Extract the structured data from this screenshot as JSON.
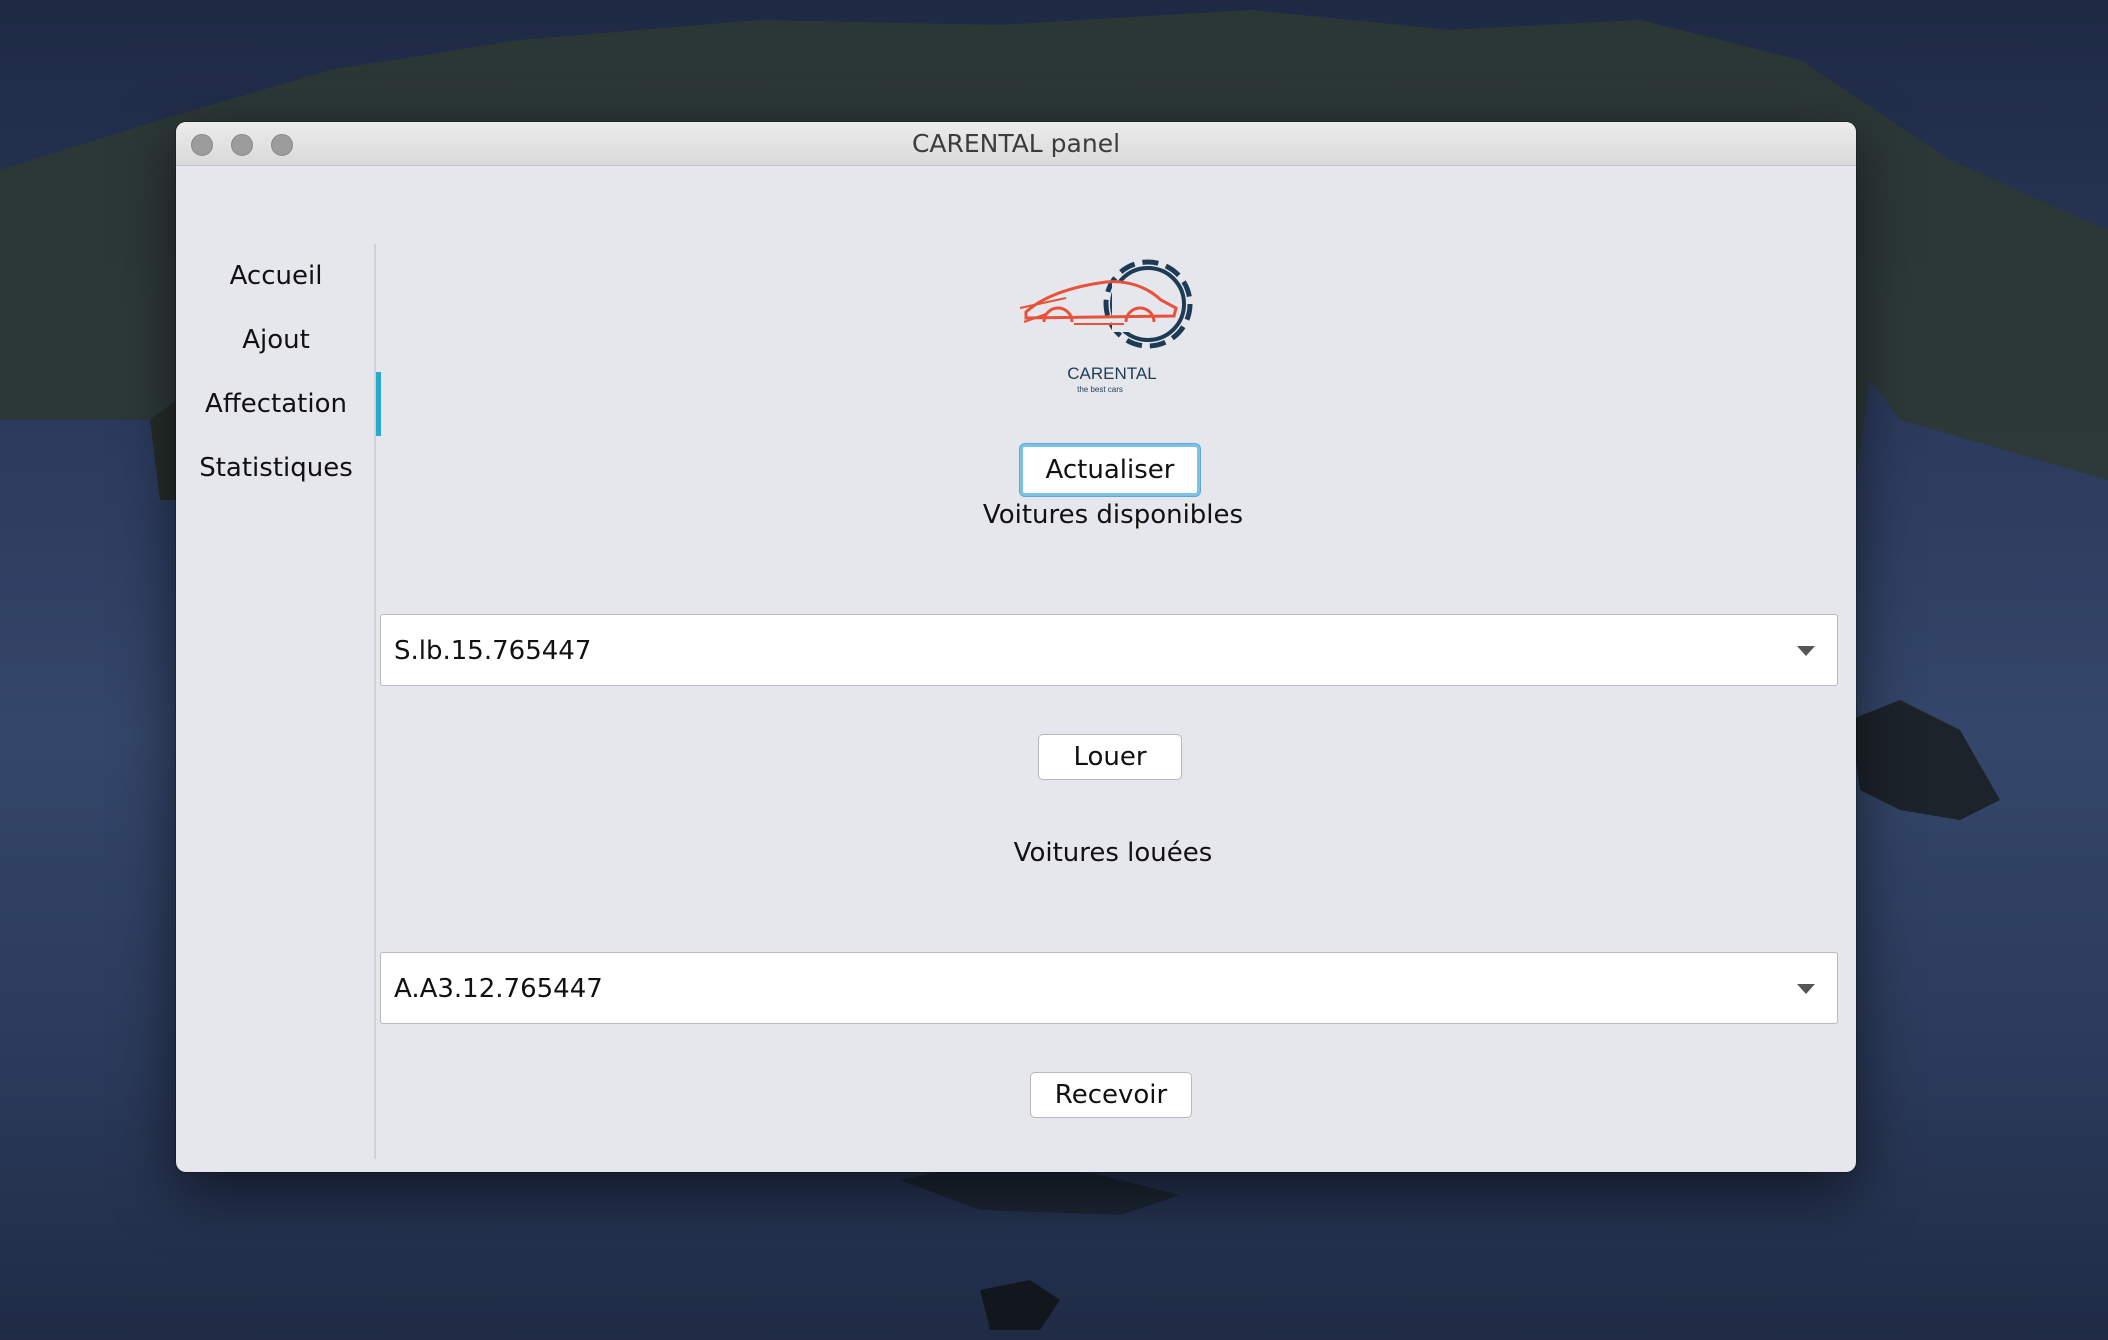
{
  "window": {
    "title": "CARENTAL panel"
  },
  "sidebar": {
    "items": [
      {
        "label": "Accueil",
        "active": false
      },
      {
        "label": "Ajout",
        "active": false
      },
      {
        "label": "Affectation",
        "active": true
      },
      {
        "label": "Statistiques",
        "active": false
      }
    ]
  },
  "logo": {
    "brand": "CARENTAL",
    "tagline": "the best cars",
    "icon": "car-gear-logo"
  },
  "main": {
    "refresh_label": "Actualiser",
    "available_title": "Voitures disponibles",
    "available_selected": "S.lb.15.765447",
    "rent_label": "Louer",
    "rented_title": "Voitures louées",
    "rented_selected": "A.A3.12.765447",
    "receive_label": "Recevoir"
  },
  "colors": {
    "accent": "#2aa7cf",
    "window_bg": "#e6e7ec",
    "logo_car": "#e8523c",
    "logo_gear": "#1d3b55"
  }
}
